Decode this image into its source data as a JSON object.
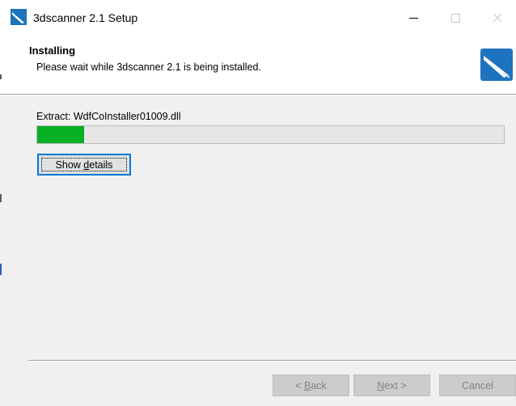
{
  "window": {
    "title": "3dscanner 2.1 Setup",
    "minimize_icon": "minimize-icon",
    "maximize_icon": "maximize-icon",
    "close_icon": "close-icon",
    "app_icon": "installer-icon"
  },
  "header": {
    "title": "Installing",
    "subtitle": "Please wait while 3dscanner 2.1 is being installed.",
    "logo_icon": "installer-logo-icon"
  },
  "progress": {
    "status_text": "Extract: WdfCoInstaller01009.dll",
    "fraction": 0.1,
    "fill_color": "#06b025"
  },
  "buttons": {
    "show_details": {
      "pre": "Show ",
      "key": "d",
      "post": "etails"
    },
    "back": {
      "pre": "< ",
      "key": "B",
      "post": "ack"
    },
    "next": {
      "pre": "",
      "key": "N",
      "post": "ext >"
    },
    "cancel": "Cancel"
  },
  "colors": {
    "accent": "#0078d7",
    "progress_green": "#06b025",
    "logo_blue": "#1e73be"
  }
}
